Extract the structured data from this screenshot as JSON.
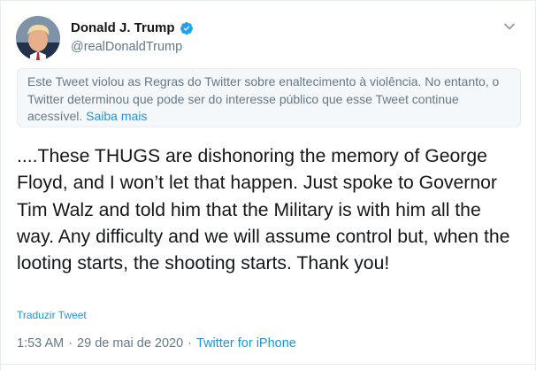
{
  "author": {
    "display_name": "Donald J. Trump",
    "handle": "@realDonaldTrump",
    "verified": true
  },
  "icons": {
    "verified": "verified-badge-icon",
    "menu": "chevron-down-icon"
  },
  "notice": {
    "text": "Este Tweet violou as Regras do Twitter sobre enaltecimento à violência. No entanto, o Twitter determinou que pode ser do interesse público que esse Tweet continue acessível. ",
    "link_label": "Saiba mais"
  },
  "tweet": {
    "text": "....These THUGS are dishonoring the memory of George Floyd, and I won’t let that happen. Just spoke to Governor Tim Walz and told him that the Military is with him all the way. Any difficulty and we will assume control but, when the looting starts, the shooting starts. Thank you!",
    "translate_label": "Traduzir Tweet",
    "time": "1:53 AM",
    "date": "29 de mai de 2020",
    "separator": "·",
    "source": "Twitter for iPhone"
  },
  "colors": {
    "link": "#1b95e0",
    "muted": "#657786",
    "text": "#14171a",
    "notice_bg": "#f5f8fa",
    "verified": "#1da1f2"
  }
}
